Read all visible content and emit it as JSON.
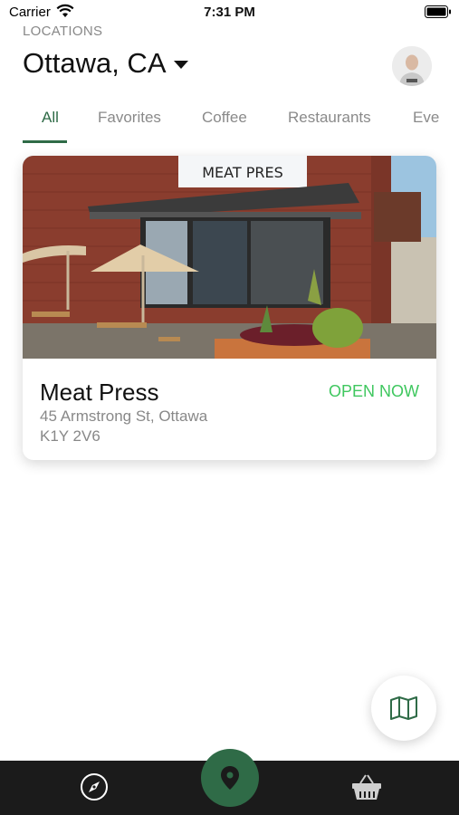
{
  "status_bar": {
    "carrier": "Carrier",
    "time": "7:31 PM"
  },
  "header": {
    "caption": "LOCATIONS",
    "city": "Ottawa, CA"
  },
  "tabs": [
    {
      "label": "All",
      "active": true
    },
    {
      "label": "Favorites",
      "active": false
    },
    {
      "label": "Coffee",
      "active": false
    },
    {
      "label": "Restaurants",
      "active": false
    },
    {
      "label": "Eve",
      "active": false
    }
  ],
  "locations": [
    {
      "name": "Meat Press",
      "status": "OPEN NOW",
      "address_line1": "45 Armstrong St, Ottawa",
      "address_line2": "K1Y 2V6",
      "sign_text": "MEAT PRES"
    }
  ],
  "colors": {
    "accent": "#2f6b47",
    "open_status": "#3fc75f",
    "nav_bg": "#1b1b1b"
  },
  "icons": {
    "map_button": "map-icon",
    "nav": [
      "compass-icon",
      "location-pin-icon",
      "basket-icon"
    ]
  }
}
